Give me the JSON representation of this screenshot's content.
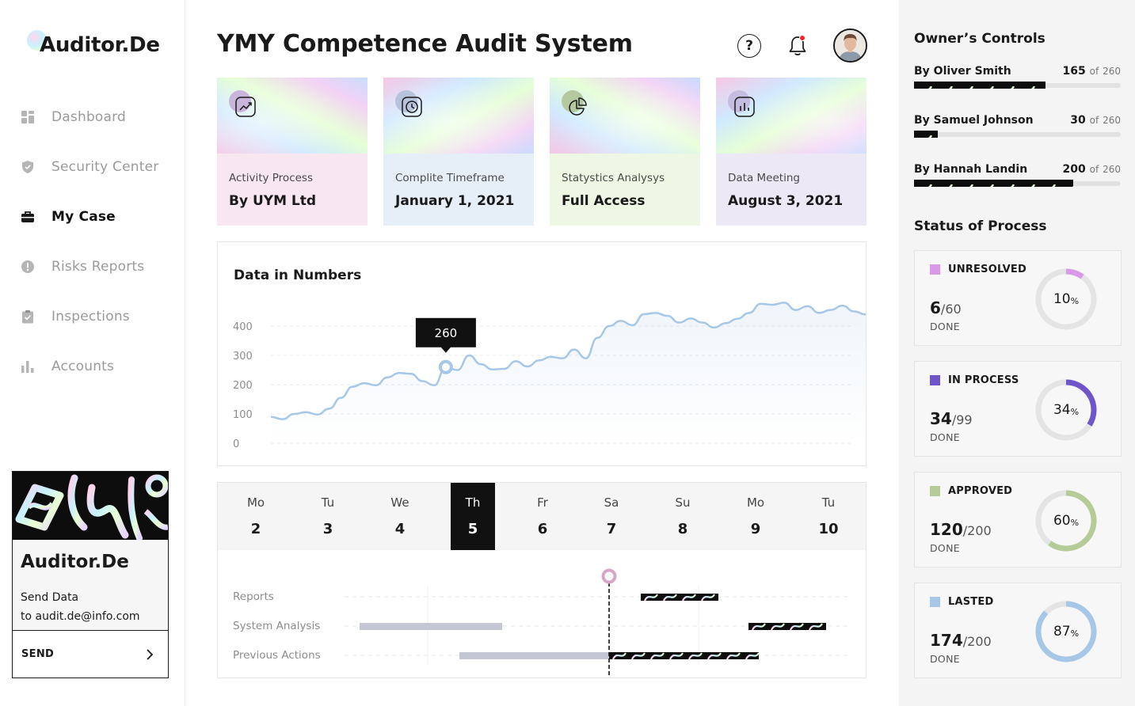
{
  "app": {
    "logo": "Auditor.De",
    "title": "YMY Competence Audit System"
  },
  "header": {
    "help_icon": "help-circle-icon",
    "help_glyph": "?",
    "bell_icon": "bell-icon",
    "notification_color": "#ff2424"
  },
  "sidebar": {
    "items": [
      {
        "label": "Dashboard",
        "icon": "dashboard-icon",
        "active": false
      },
      {
        "label": "Security Center",
        "icon": "shield-icon",
        "active": false
      },
      {
        "label": "My Case",
        "icon": "briefcase-icon",
        "active": true
      },
      {
        "label": "Risks Reports",
        "icon": "alert-icon",
        "active": false
      },
      {
        "label": "Inspections",
        "icon": "clipboard-check-icon",
        "active": false
      },
      {
        "label": "Accounts",
        "icon": "bar-chart-icon",
        "active": false
      }
    ],
    "promo": {
      "title": "Auditor.De",
      "line1": "Send Data",
      "line2": "to audit.de@info.com",
      "button": "SEND"
    }
  },
  "cards": [
    {
      "label": "Activity Process",
      "value": "By UYM Ltd",
      "icon": "trend-chart-icon",
      "bg": "#f8e6f0"
    },
    {
      "label": "Complite Timeframe",
      "value": "January 1, 2021",
      "icon": "clock-icon",
      "bg": "#e6eef8"
    },
    {
      "label": "Statystics Analysys",
      "value": "Full Access",
      "icon": "pie-chart-icon",
      "bg": "#eef6e4"
    },
    {
      "label": "Data Meeting",
      "value": "August 3, 2021",
      "icon": "bar-chart-box-icon",
      "bg": "#ece8f6"
    }
  ],
  "chart_data": {
    "type": "line",
    "title": "Data in Numbers",
    "xlabel": "",
    "ylabel": "",
    "ylim": [
      0,
      400
    ],
    "yticks": [
      0,
      100,
      200,
      300,
      400
    ],
    "grid": true,
    "legend": "none",
    "color": "#a7c7e7",
    "y": [
      90,
      82,
      100,
      106,
      98,
      118,
      155,
      193,
      205,
      198,
      225,
      240,
      237,
      212,
      198,
      260,
      250,
      300,
      270,
      252,
      254,
      280,
      262,
      283,
      295,
      290,
      320,
      290,
      360,
      400,
      418,
      403,
      441,
      445,
      435,
      412,
      426,
      412,
      395,
      410,
      425,
      445,
      476,
      473,
      480,
      455,
      468,
      445,
      455,
      470,
      450,
      440
    ],
    "highlight": {
      "index": 15,
      "label": "260"
    }
  },
  "timeline": {
    "days": [
      {
        "name": "Mo",
        "date": "2"
      },
      {
        "name": "Tu",
        "date": "3"
      },
      {
        "name": "We",
        "date": "4"
      },
      {
        "name": "Th",
        "date": "5",
        "active": true
      },
      {
        "name": "Fr",
        "date": "6"
      },
      {
        "name": "Sa",
        "date": "7"
      },
      {
        "name": "Su",
        "date": "8"
      },
      {
        "name": "Mo",
        "date": "9"
      },
      {
        "name": "Tu",
        "date": "10"
      }
    ],
    "rows": [
      "Reports",
      "System Analysis",
      "Previous Actions"
    ],
    "marker_color": "#d9a6c8"
  },
  "owners": {
    "heading": "Owner’s Controls",
    "of_label": "of",
    "items": [
      {
        "name": "By Oliver Smith",
        "value": "165",
        "total": "260",
        "fraction": 0.635
      },
      {
        "name": "By Samuel Johnson",
        "value": "30",
        "total": "260",
        "fraction": 0.115
      },
      {
        "name": "By Hannah Landin",
        "value": "200",
        "total": "260",
        "fraction": 0.769
      }
    ]
  },
  "status": {
    "heading": "Status of Process",
    "done_label": "DONE",
    "items": [
      {
        "label": "UNRESOLVED",
        "count": "6",
        "total": "/60",
        "percent": "10",
        "fraction": 0.1,
        "color": "#d89ae6"
      },
      {
        "label": "IN PROCESS",
        "count": "34",
        "total": "/99",
        "percent": "34",
        "fraction": 0.34,
        "color": "#6f55c9"
      },
      {
        "label": "APPROVED",
        "count": "120",
        "total": "/200",
        "percent": "60",
        "fraction": 0.6,
        "color": "#b5cc98"
      },
      {
        "label": "LASTED",
        "count": "174",
        "total": "/200",
        "percent": "87",
        "fraction": 0.87,
        "color": "#a7c7e7"
      }
    ],
    "percent_sign": "%"
  }
}
